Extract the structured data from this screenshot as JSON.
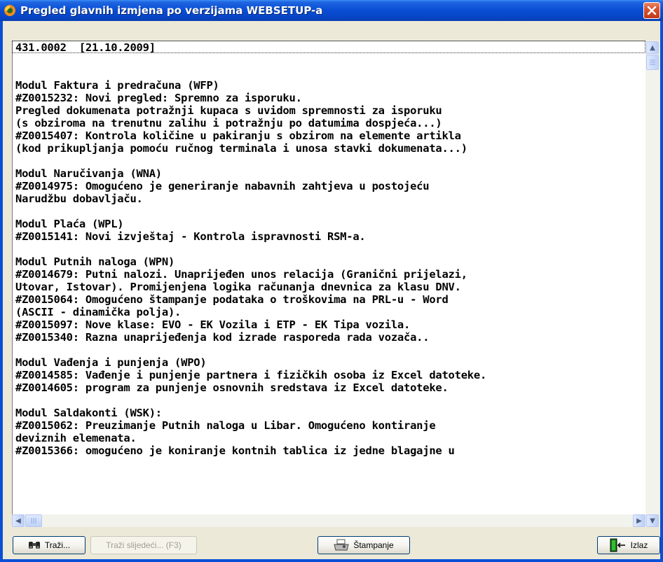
{
  "window": {
    "title": "Pregled glavnih izmjena po verzijama WEBSETUP-a",
    "close_glyph": "✕"
  },
  "content": {
    "lines": [
      "431.0002  [21.10.2009]",
      "",
      "",
      "Modul Faktura i predračuna (WFP)",
      "#Z0015232: Novi pregled: Spremno za isporuku.",
      "Pregled dokumenata potražnji kupaca s uvidom spremnosti za isporuku",
      "(s obziroma na trenutnu zalihu i potražnju po datumima dospjeća...)",
      "#Z0015407: Kontrola količine u pakiranju s obzirom na elemente artikla",
      "(kod prikupljanja pomoću ručnog terminala i unosa stavki dokumenata...)",
      "",
      "Modul Naručivanja (WNA)",
      "#Z0014975: Omogućeno je generiranje nabavnih zahtjeva u postojeću",
      "Narudžbu dobavljaču.",
      "",
      "Modul Plaća (WPL)",
      "#Z0015141: Novi izvještaj - Kontrola ispravnosti RSM-a.",
      "",
      "Modul Putnih naloga (WPN)",
      "#Z0014679: Putni nalozi. Unaprijeđen unos relacija (Granični prijelazi,",
      "Utovar, Istovar). Promijenjena logika računanja dnevnica za klasu DNV.",
      "#Z0015064: Omogućeno štampanje podataka o troškovima na PRL-u - Word",
      "(ASCII - dinamička polja).",
      "#Z0015097: Nove klase: EVO - EK Vozila i ETP - EK Tipa vozila.",
      "#Z0015340: Razna unaprijeđenja kod izrade rasporeda rada vozača..",
      "",
      "Modul Vađenja i punjenja (WPO)",
      "#Z0014585: Vađenje i punjenje partnera i fizičkih osoba iz Excel datoteke.",
      "#Z0014605: program za punjenje osnovnih sredstava iz Excel datoteke.",
      "",
      "Modul Saldakonti (WSK):",
      "#Z0015062: Preuzimanje Putnih naloga u Libar. Omogućeno kontiranje",
      "deviznih elemenata.",
      "#Z0015366: omogućeno je koniranje kontnih tablica iz jedne blagajne u"
    ]
  },
  "scrollbars": {
    "up_glyph": "▲",
    "down_glyph": "▼",
    "left_glyph": "◀",
    "right_glyph": "▶"
  },
  "buttons": {
    "find_label": "Traži...",
    "find_next_label": "Traži slijedeći... (F3)",
    "print_label": "Štampanje",
    "exit_label": "Izlaz"
  },
  "icons": {
    "app": "app-logo-icon",
    "find": "binoculars-icon",
    "print": "printer-icon",
    "exit": "exit-door-icon"
  },
  "colors": {
    "titlebar": "#0a4fd6",
    "close": "#d9532f",
    "face": "#ece9d8"
  }
}
